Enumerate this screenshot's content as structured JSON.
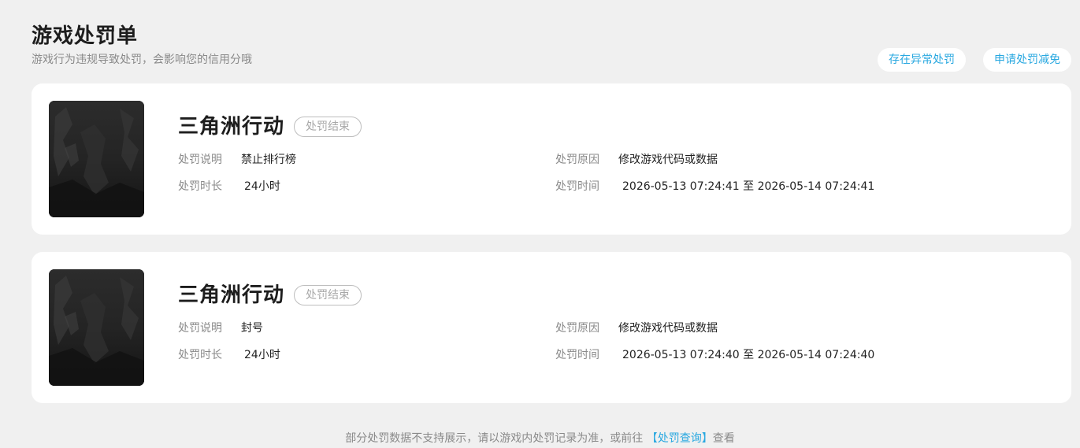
{
  "header": {
    "title": "游戏处罚单",
    "subtitle": "游戏行为违规导致处罚，会影响您的信用分哦",
    "actions": {
      "report_abnormal": "存在异常处罚",
      "apply_reduction": "申请处罚减免"
    }
  },
  "records": [
    {
      "game_name": "三角洲行动",
      "status": "处罚结束",
      "description_label": "处罚说明",
      "description": "禁止排行榜",
      "reason_label": "处罚原因",
      "reason": "修改游戏代码或数据",
      "duration_label": "处罚时长",
      "duration": "24小时",
      "time_label": "处罚时间",
      "time_range": "2026-05-13 07:24:41 至 2026-05-14 07:24:41"
    },
    {
      "game_name": "三角洲行动",
      "status": "处罚结束",
      "description_label": "处罚说明",
      "description": "封号",
      "reason_label": "处罚原因",
      "reason": "修改游戏代码或数据",
      "duration_label": "处罚时长",
      "duration": "24小时",
      "time_label": "处罚时间",
      "time_range": "2026-05-13 07:24:40 至 2026-05-14 07:24:40"
    }
  ],
  "footer": {
    "note_prefix": "部分处罚数据不支持展示，请以游戏内处罚记录为准，或前往",
    "link_text": "【处罚查询】",
    "note_suffix": "查看"
  },
  "colors": {
    "accent": "#29a8e0",
    "background": "#f0f0f0",
    "card": "#ffffff"
  }
}
